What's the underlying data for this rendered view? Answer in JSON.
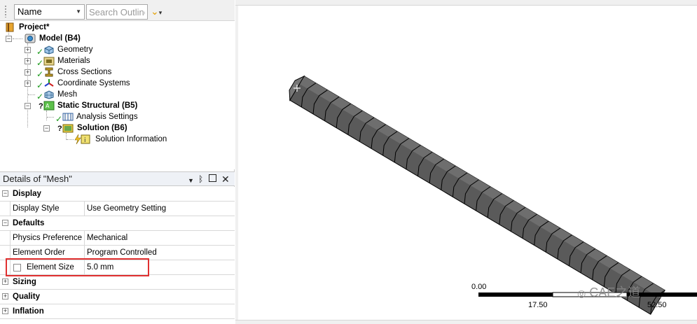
{
  "outline": {
    "name_combo": "Name",
    "search_placeholder": "Search Outline",
    "tree": {
      "project": "Project*",
      "model": "Model (B4)",
      "geometry": "Geometry",
      "materials": "Materials",
      "cross_sections": "Cross Sections",
      "coordinate_systems": "Coordinate Systems",
      "mesh": "Mesh",
      "static_structural": "Static Structural (B5)",
      "analysis_settings": "Analysis Settings",
      "solution": "Solution (B6)",
      "solution_information": "Solution Information"
    }
  },
  "details": {
    "title": "Details of \"Mesh\"",
    "groups": {
      "display": "Display",
      "defaults": "Defaults",
      "sizing": "Sizing",
      "quality": "Quality",
      "inflation": "Inflation"
    },
    "rows": {
      "display_style": {
        "key": "Display Style",
        "value": "Use Geometry Setting"
      },
      "physics_preference": {
        "key": "Physics Preference",
        "value": "Mechanical"
      },
      "element_order": {
        "key": "Element Order",
        "value": "Program Controlled"
      },
      "element_size": {
        "key": "Element Size",
        "value": "5.0 mm"
      }
    }
  },
  "viewport": {
    "scale_labels": {
      "start": "0.00",
      "mid": "17.50",
      "end": "52.50"
    },
    "watermark": "CAE之道"
  },
  "colors": {
    "mesh_face": "#5a5a5a",
    "mesh_edge": "#000000",
    "highlight": "#e03030",
    "check": "#1a9a1a"
  }
}
